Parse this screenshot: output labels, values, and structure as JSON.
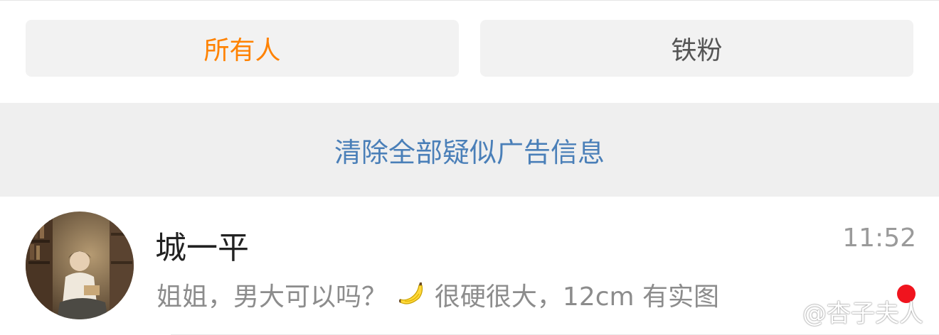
{
  "filter_tabs": [
    {
      "label": "所有人",
      "active": true
    },
    {
      "label": "铁粉",
      "active": false
    }
  ],
  "clear_ads_label": "清除全部疑似广告信息",
  "messages": [
    {
      "sender": "城一平",
      "time": "11:52",
      "preview_before_emoji": "姐姐，男大可以吗？",
      "emoji_icon": "banana-icon",
      "preview_after_emoji": "很硬很大，12cm 有实图",
      "unread": true
    }
  ],
  "watermark": {
    "text": "@杏子夫人",
    "icon": "weibo-logo-icon"
  },
  "colors": {
    "active_tab": "#ff8200",
    "link_blue": "#4a7fb8",
    "unread_red": "#f0141e"
  }
}
